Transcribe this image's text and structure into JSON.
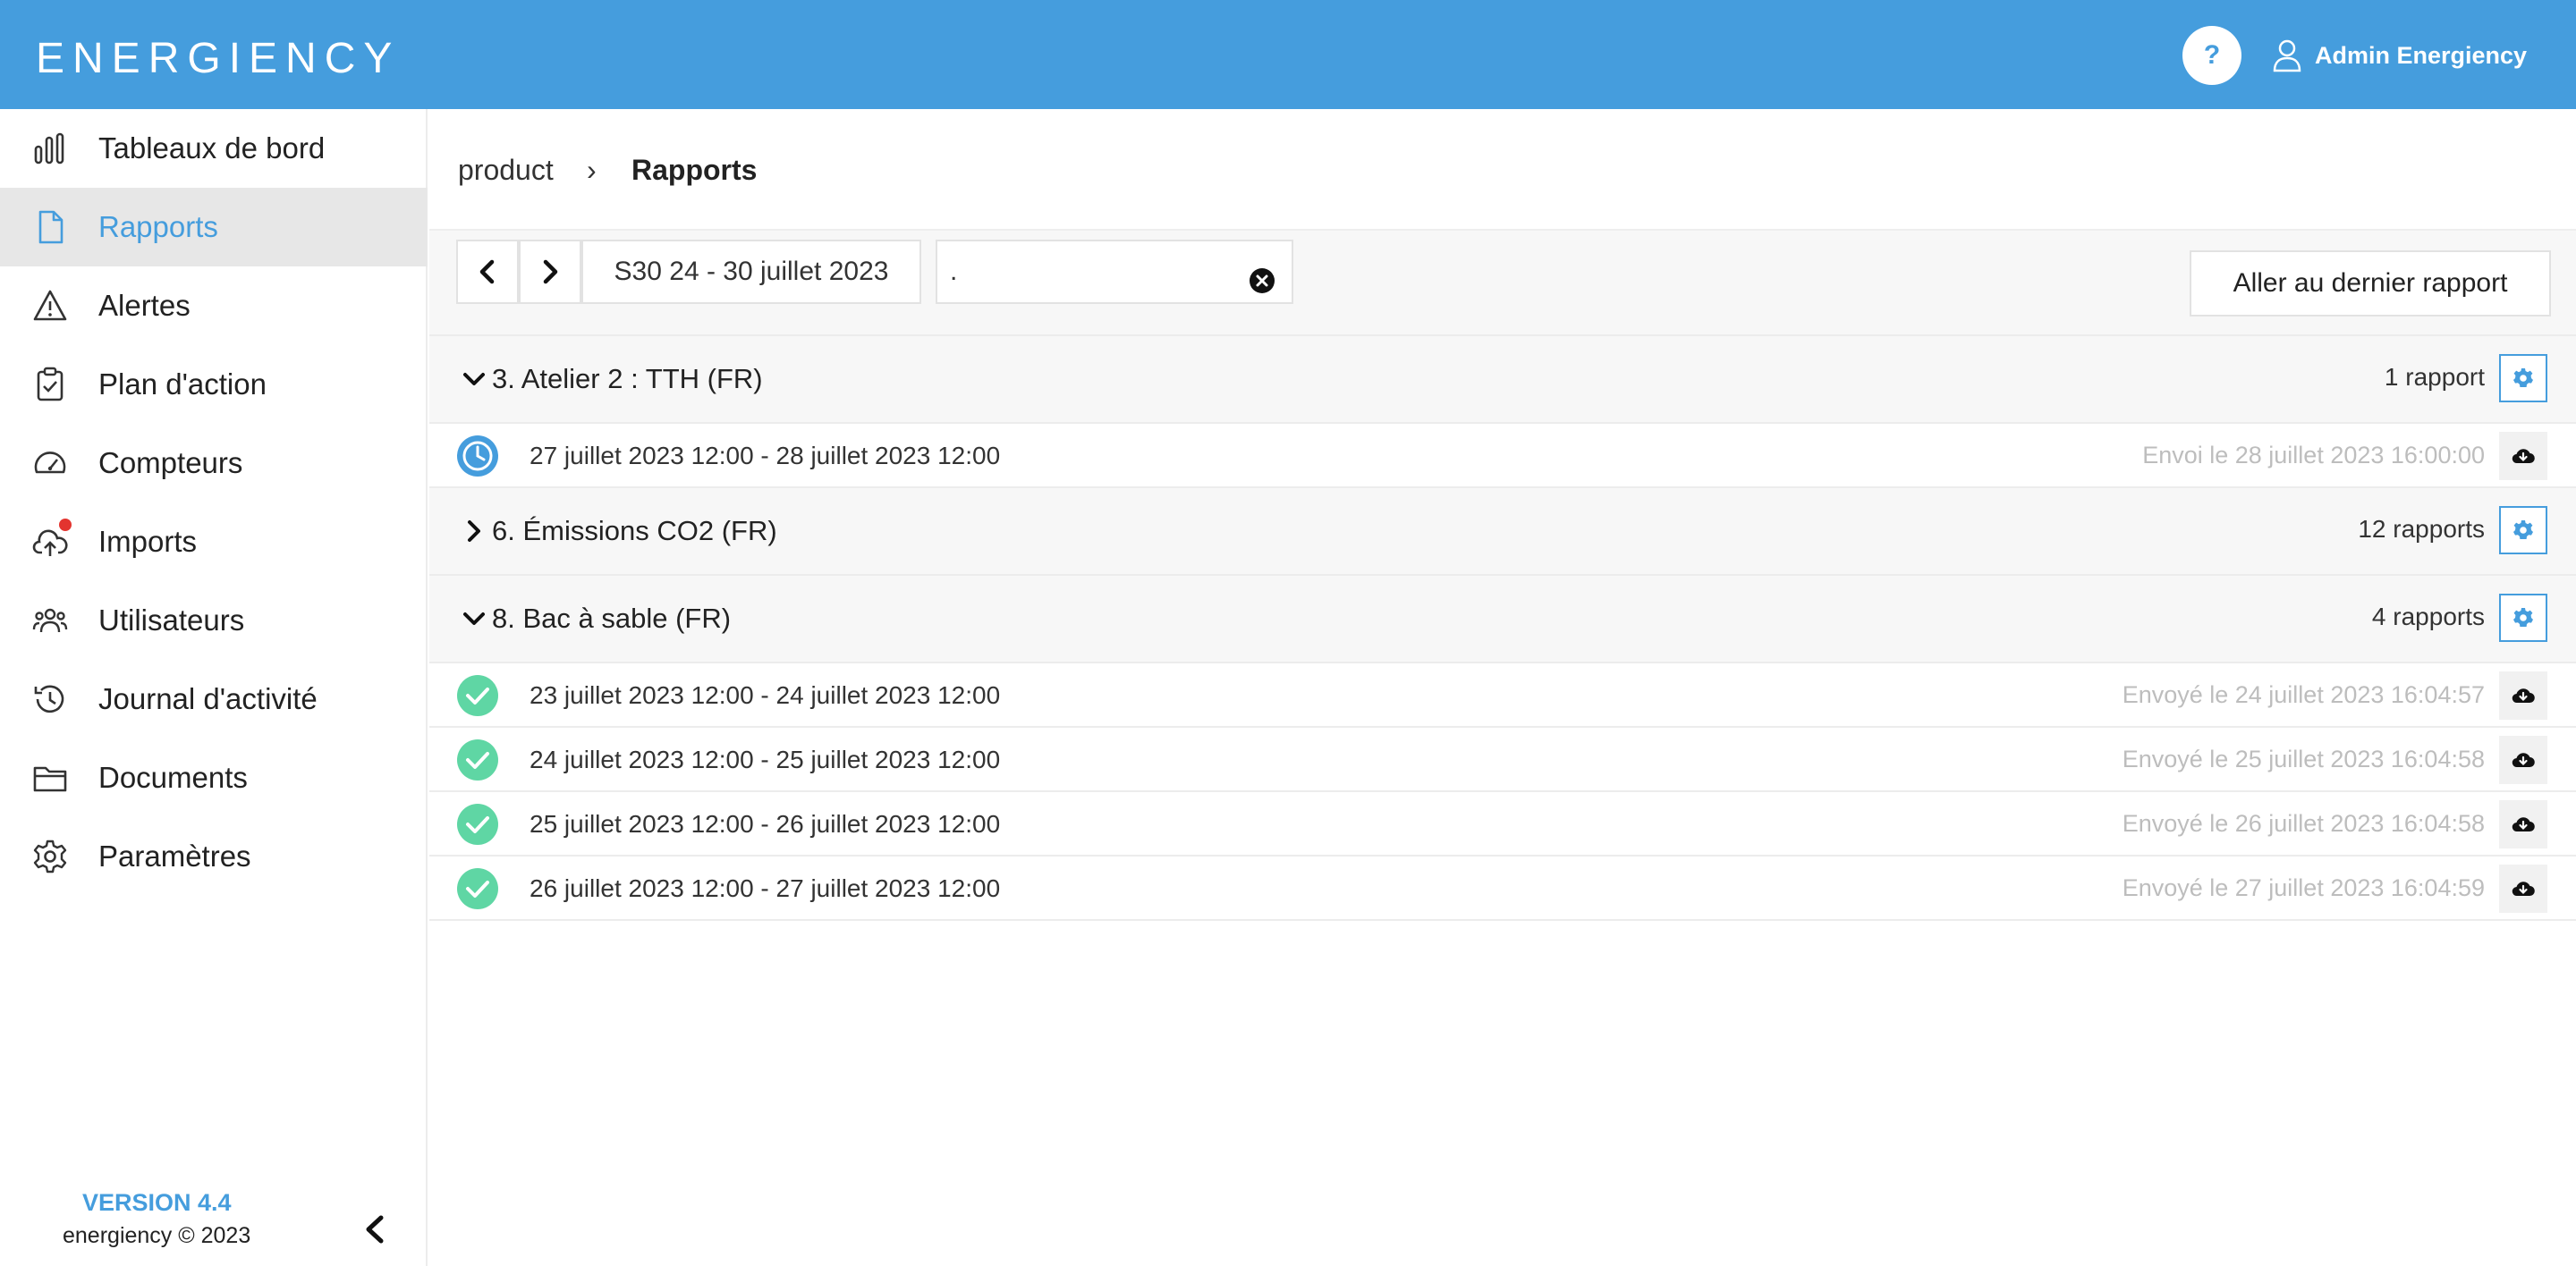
{
  "header": {
    "logo": "ENERGIENCY",
    "help_label": "?",
    "user_name": "Admin Energiency",
    "color": "#459ddd"
  },
  "sidebar": {
    "items": [
      {
        "label": "Tableaux de bord",
        "icon": "bar-chart-icon"
      },
      {
        "label": "Rapports",
        "icon": "document-icon",
        "active": true
      },
      {
        "label": "Alertes",
        "icon": "warning-icon"
      },
      {
        "label": "Plan d'action",
        "icon": "clipboard-check-icon"
      },
      {
        "label": "Compteurs",
        "icon": "gauge-icon"
      },
      {
        "label": "Imports",
        "icon": "cloud-upload-icon",
        "badge_color": "#e3342f"
      },
      {
        "label": "Utilisateurs",
        "icon": "users-icon"
      },
      {
        "label": "Journal d'activité",
        "icon": "history-icon"
      },
      {
        "label": "Documents",
        "icon": "folder-icon"
      },
      {
        "label": "Paramètres",
        "icon": "gear-icon"
      }
    ],
    "version": "VERSION 4.4",
    "copyright": "energiency © 2023"
  },
  "breadcrumb": {
    "root": "product",
    "separator": "›",
    "current": "Rapports"
  },
  "toolbar": {
    "week": "S30 24 - 30 juillet 2023",
    "search_value": ".",
    "last_report_label": "Aller au dernier rapport"
  },
  "groups": [
    {
      "title": "3. Atelier 2 : TTH (FR)",
      "count": "1 rapport",
      "expanded": true,
      "reports": [
        {
          "period": "27 juillet 2023 12:00 - 28 juillet 2023 12:00",
          "sent": "Envoi le 28 juillet 2023 16:00:00",
          "status": "scheduled"
        }
      ]
    },
    {
      "title": "6. Émissions CO2 (FR)",
      "count": "12 rapports",
      "expanded": false,
      "reports": []
    },
    {
      "title": "8. Bac à sable (FR)",
      "count": "4 rapports",
      "expanded": true,
      "reports": [
        {
          "period": "23 juillet 2023 12:00 - 24 juillet 2023 12:00",
          "sent": "Envoyé le 24 juillet 2023 16:04:57",
          "status": "sent"
        },
        {
          "period": "24 juillet 2023 12:00 - 25 juillet 2023 12:00",
          "sent": "Envoyé le 25 juillet 2023 16:04:58",
          "status": "sent"
        },
        {
          "period": "25 juillet 2023 12:00 - 26 juillet 2023 12:00",
          "sent": "Envoyé le 26 juillet 2023 16:04:58",
          "status": "sent"
        },
        {
          "period": "26 juillet 2023 12:00 - 27 juillet 2023 12:00",
          "sent": "Envoyé le 27 juillet 2023 16:04:59",
          "status": "sent"
        }
      ]
    }
  ],
  "colors": {
    "accent": "#459ddd",
    "success": "#5fd6a4",
    "badge": "#e3342f"
  }
}
